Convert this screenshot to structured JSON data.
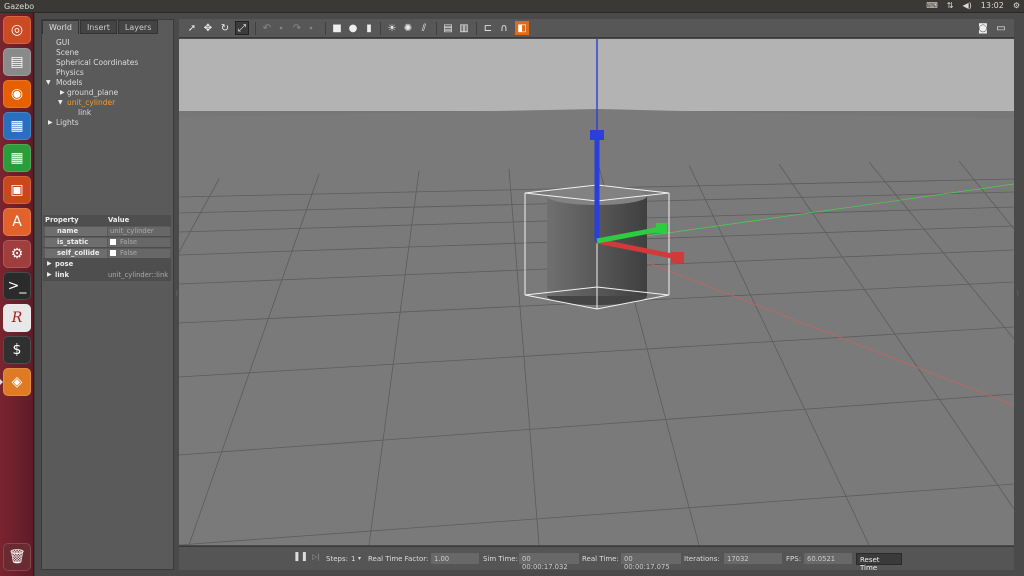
{
  "system": {
    "app_title": "Gazebo",
    "clock": "13:02",
    "tray_icons": [
      "keyboard-icon",
      "network-icon",
      "volume-icon",
      "settings-gear-icon"
    ]
  },
  "launcher": {
    "items": [
      {
        "name": "ubuntu-dash-icon",
        "color": "#c94a23"
      },
      {
        "name": "files-icon",
        "color": "#7d7d7d"
      },
      {
        "name": "firefox-icon",
        "color": "#e66000"
      },
      {
        "name": "writer-icon",
        "color": "#2a6fbd"
      },
      {
        "name": "calc-icon",
        "color": "#2c9b3a"
      },
      {
        "name": "impress-icon",
        "color": "#c8481c"
      },
      {
        "name": "software-center-icon",
        "color": "#e2622c"
      },
      {
        "name": "system-settings-icon",
        "color": "#9a3b3b"
      },
      {
        "name": "terminal-icon",
        "color": "#2b2b2b"
      },
      {
        "name": "rstudio-icon",
        "color": "#e8e8e8"
      },
      {
        "name": "gnome-terminal-icon",
        "color": "#303030"
      },
      {
        "name": "gazebo-icon",
        "color": "#e07b25"
      }
    ],
    "trash": {
      "name": "trash-icon"
    }
  },
  "left_panel": {
    "tabs": [
      "World",
      "Insert",
      "Layers"
    ],
    "active_tab": "World",
    "tree": {
      "gui": "GUI",
      "scene": "Scene",
      "spherical": "Spherical Coordinates",
      "physics": "Physics",
      "models": "Models",
      "ground_plane": "ground_plane",
      "unit_cylinder": "unit_cylinder",
      "link": "link",
      "lights": "Lights"
    },
    "properties": {
      "header_property": "Property",
      "header_value": "Value",
      "name_key": "name",
      "name_value": "unit_cylinder",
      "static_key": "is_static",
      "static_value": "False",
      "collide_key": "self_collide",
      "collide_value": "False",
      "pose_key": "pose",
      "link_key": "link",
      "link_value": "unit_cylinder::link"
    }
  },
  "toolbar": {
    "tools": [
      "select-arrow-icon",
      "translate-icon",
      "rotate-icon",
      "scale-icon",
      "undo-icon",
      "undo-dropdown-icon",
      "redo-icon",
      "redo-dropdown-icon",
      "box-shape-icon",
      "sphere-shape-icon",
      "cylinder-shape-icon",
      "point-light-icon",
      "spot-light-icon",
      "directional-light-icon",
      "copy-icon",
      "paste-icon",
      "align-icon",
      "snap-icon",
      "view-angle-icon",
      "screenshot-icon",
      "record-video-icon"
    ],
    "active_tool": "scale-icon"
  },
  "status": {
    "steps_label": "Steps:",
    "steps_value": "1",
    "rtf_label": "Real Time Factor:",
    "rtf_value": "1.00",
    "sim_label": "Sim Time:",
    "sim_value": "00 00:00:17.032",
    "real_label": "Real Time:",
    "real_value": "00 00:00:17.075",
    "iter_label": "Iterations:",
    "iter_value": "17032",
    "fps_label": "FPS:",
    "fps_value": "60.0521",
    "reset_label": "Reset Time"
  },
  "colors": {
    "selection_orange": "#f39a2a",
    "axis_x": "#d23a3a",
    "axis_y": "#2ecc40",
    "axis_z": "#2a3fd8",
    "ground": "#7a7a7a",
    "sky": "#b3b3b3"
  }
}
